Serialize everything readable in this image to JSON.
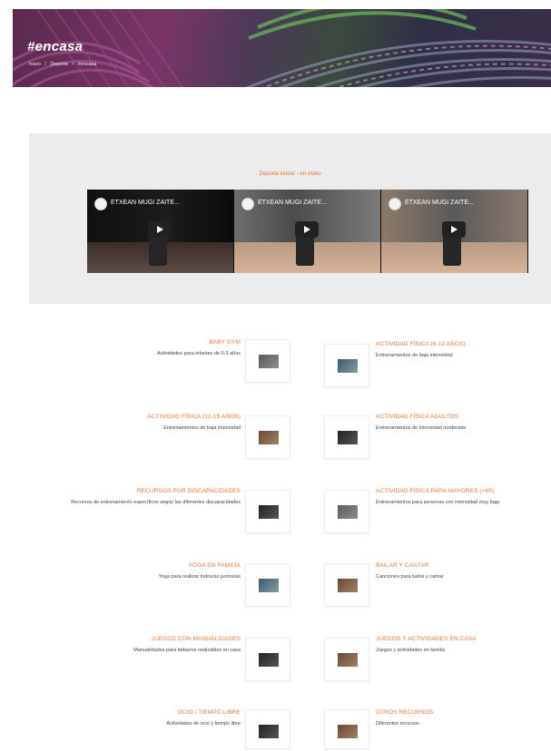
{
  "banner": {
    "title": "#encasa",
    "breadcrumb": [
      "Inicio",
      "/",
      "Deporte",
      "/",
      "#encasa"
    ]
  },
  "video_section": {
    "title": "Deporte indoor - en vídeo",
    "videos": [
      {
        "title": "ETXEAN MUGI ZAITE..."
      },
      {
        "title": "ETXEAN MUGI ZAITE..."
      },
      {
        "title": "ETXEAN MUGI ZAITE..."
      }
    ]
  },
  "categories": {
    "left": [
      {
        "title": "BABY GYM",
        "desc": "Actividades para infantes de 0-3 años"
      },
      {
        "title": "ACTIVIDAD FÍSICA (12-15 años)",
        "desc": "Entrenamientos de baja intensidad"
      },
      {
        "title": "RECURSOS POR DISCAPACIDADES",
        "desc": "Recursos de entrenamiento específicos según las diferentes discapacidades"
      },
      {
        "title": "YOGA EN FAMILIA",
        "desc": "Yoga para realizar todos/as juntos/as"
      },
      {
        "title": "JUEGOS CON MANUALIDADES",
        "desc": "Manualidades para todas/os realizables en casa"
      },
      {
        "title": "OCIO / TIEMPO LIBRE",
        "desc": "Actividades de ocio y tiempo libre"
      }
    ],
    "right": [
      {
        "title": "ACTIVIDAD FÍSICA (6-12 años)",
        "desc": "Entrenamientos de baja intensidad"
      },
      {
        "title": "ACTIVIDAD FÍSICA ADULTOS",
        "desc": "Entrenamientos de intensidad moderada"
      },
      {
        "title": "ACTIVIDAD FÍSICA PARA MAYORES (+65)",
        "desc": "Entrenamientos para personas con intensidad muy baja"
      },
      {
        "title": "BAILAR Y CANTAR",
        "desc": "Canciones para bailar y cantar"
      },
      {
        "title": "JUEGOS Y ACTIVIDADES EN CASA",
        "desc": "Juegos y actividades en familia"
      },
      {
        "title": "OTROS RECURSOS",
        "desc": "Diferentes recursos"
      }
    ]
  }
}
